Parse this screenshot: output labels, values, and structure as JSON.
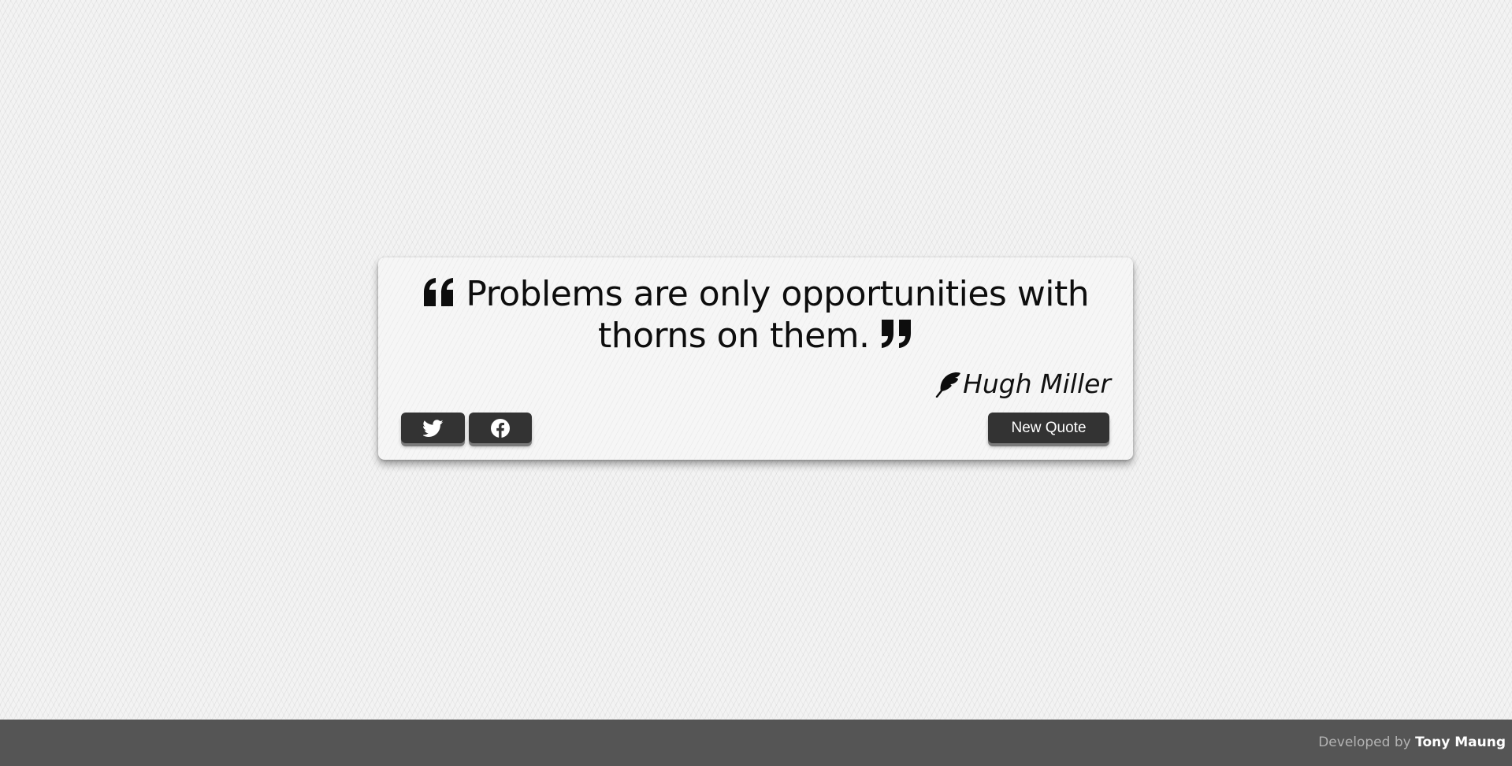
{
  "quote": {
    "text": "Problems are only opportunities with thorns on them.",
    "author": "Hugh Miller",
    "open_icon": "quote-left-icon",
    "close_icon": "quote-right-icon",
    "author_icon": "feather-icon"
  },
  "actions": {
    "twitter_icon": "twitter-icon",
    "facebook_icon": "facebook-icon",
    "new_quote_label": "New Quote"
  },
  "footer": {
    "prefix": "Developed by",
    "name": "Tony Maung"
  },
  "colors": {
    "button_bg": "#333333",
    "footer_bg": "#555555",
    "card_bg": "#f6f6f6"
  }
}
